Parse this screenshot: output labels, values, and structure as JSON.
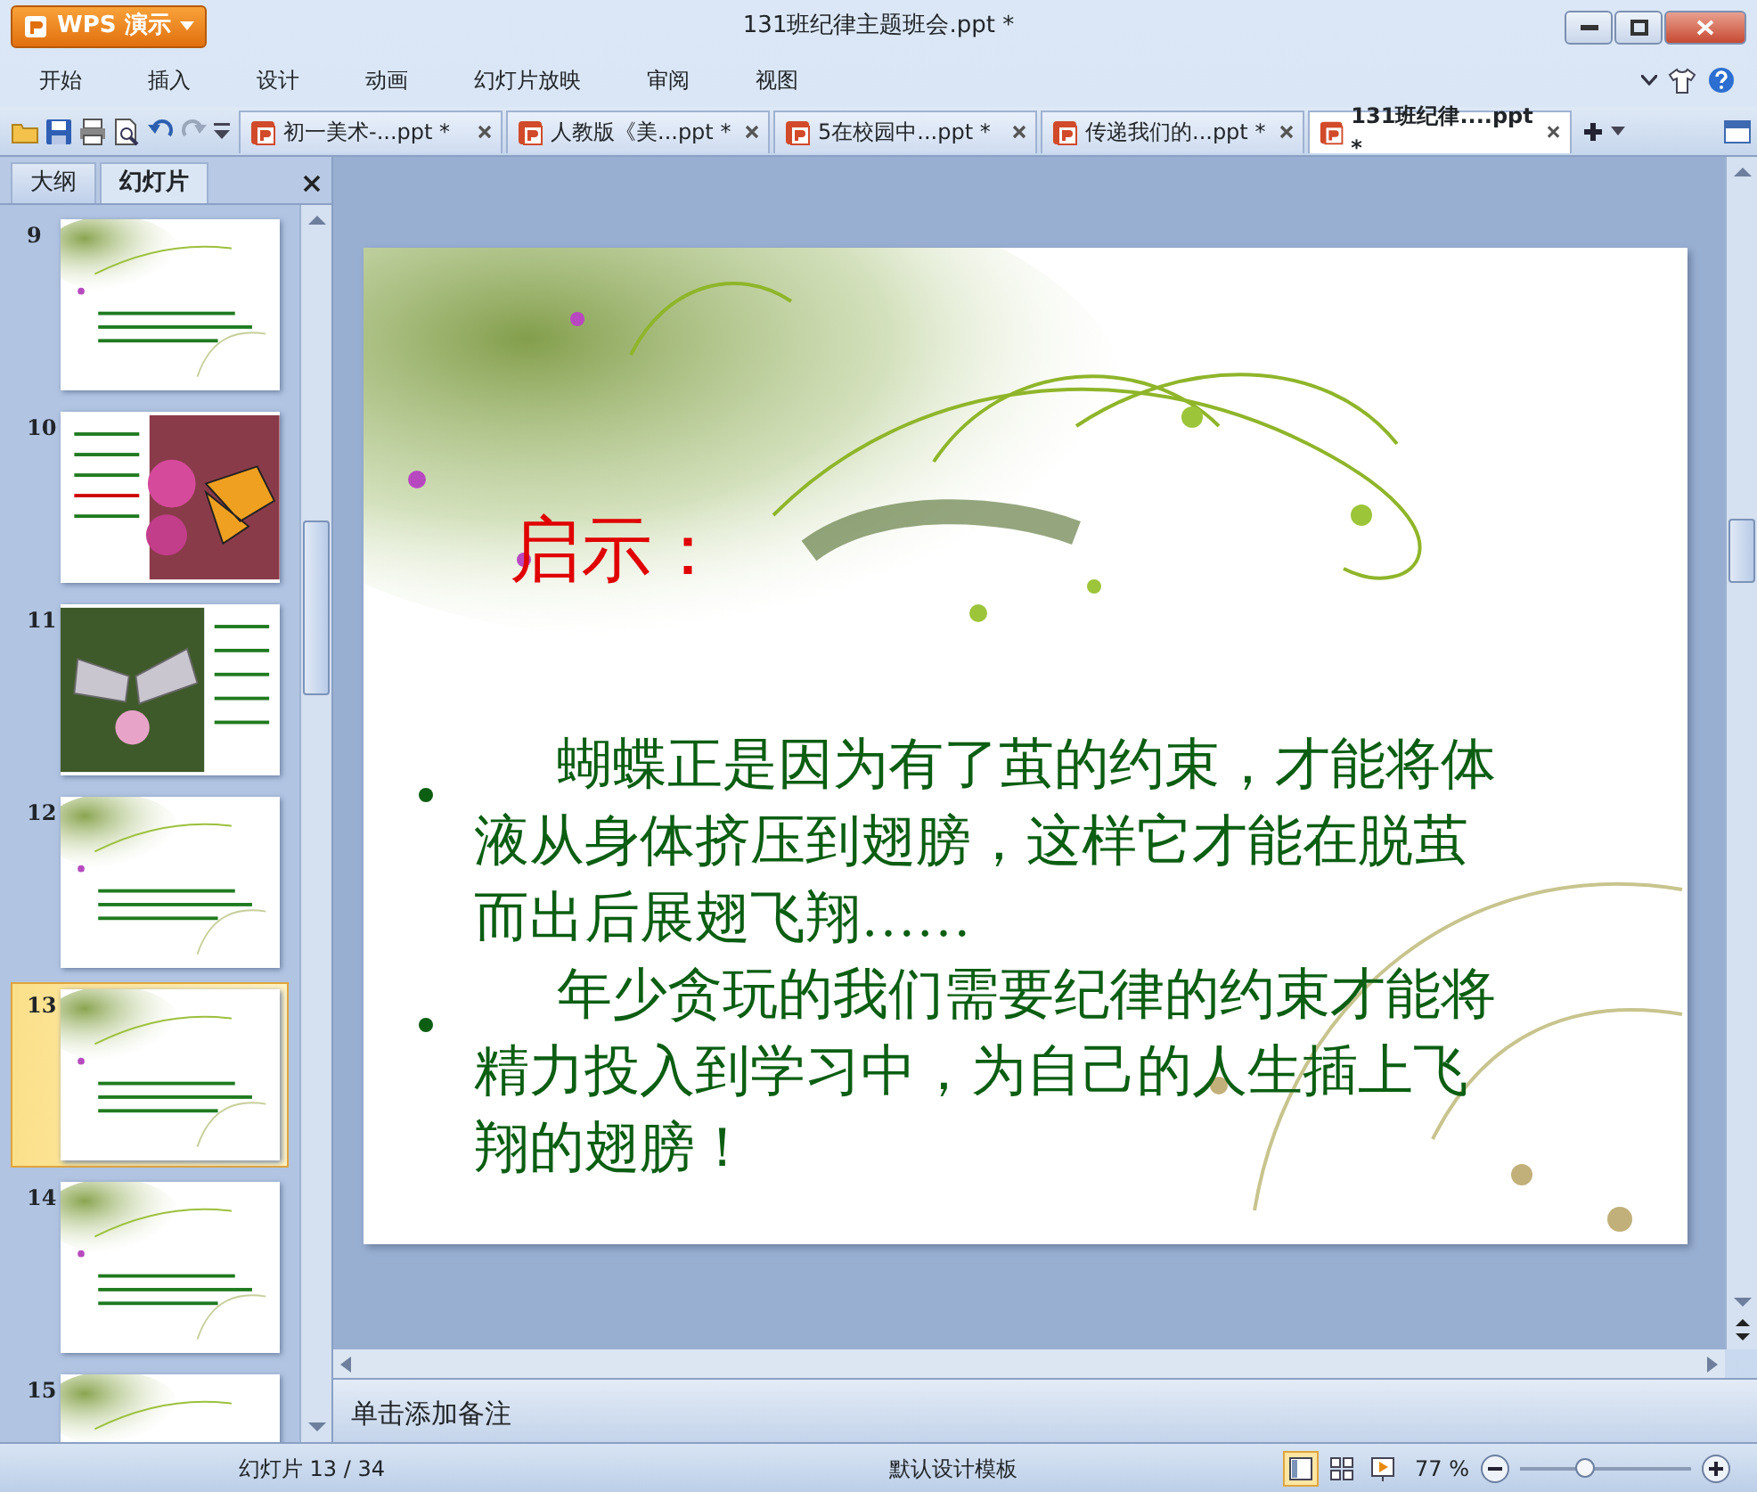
{
  "window": {
    "app_button": "WPS 演示",
    "title": "131班纪律主题班会.ppt *"
  },
  "menu": [
    "开始",
    "插入",
    "设计",
    "动画",
    "幻灯片放映",
    "审阅",
    "视图"
  ],
  "doc_tabs": [
    {
      "label": "初一美术-...ppt *",
      "selected": false
    },
    {
      "label": "人教版《美...ppt *",
      "selected": false
    },
    {
      "label": "5在校园中...ppt *",
      "selected": false
    },
    {
      "label": "传递我们的...ppt *",
      "selected": false
    },
    {
      "label": "131班纪律....ppt *",
      "selected": true
    }
  ],
  "panel_tabs": [
    {
      "label": "大纲",
      "selected": false
    },
    {
      "label": "幻灯片",
      "selected": true
    }
  ],
  "thumbnails": [
    {
      "number": "9",
      "kind": "floral-text",
      "selected": false
    },
    {
      "number": "10",
      "kind": "butterfly-right",
      "selected": false
    },
    {
      "number": "11",
      "kind": "butterfly-left",
      "selected": false
    },
    {
      "number": "12",
      "kind": "floral-text",
      "selected": false
    },
    {
      "number": "13",
      "kind": "floral-text",
      "selected": true
    },
    {
      "number": "14",
      "kind": "floral-text",
      "selected": false
    },
    {
      "number": "15",
      "kind": "floral-text",
      "selected": false
    }
  ],
  "slide": {
    "heading": "启示：",
    "bullets": [
      "蝴蝶正是因为有了茧的约束，才能将体液从身体挤压到翅膀，这样它才能在脱茧而出后展翅飞翔……",
      "年少贪玩的我们需要纪律的约束才能将精力投入到学习中，为自己的人生插上飞翔的翅膀！"
    ]
  },
  "notes": {
    "placeholder": "单击添加备注"
  },
  "status_bar": {
    "slide_counter": "幻灯片 13 / 34",
    "template": "默认设计模板",
    "zoom": "77 %",
    "zoom_level": {
      "level": 0.38
    }
  }
}
